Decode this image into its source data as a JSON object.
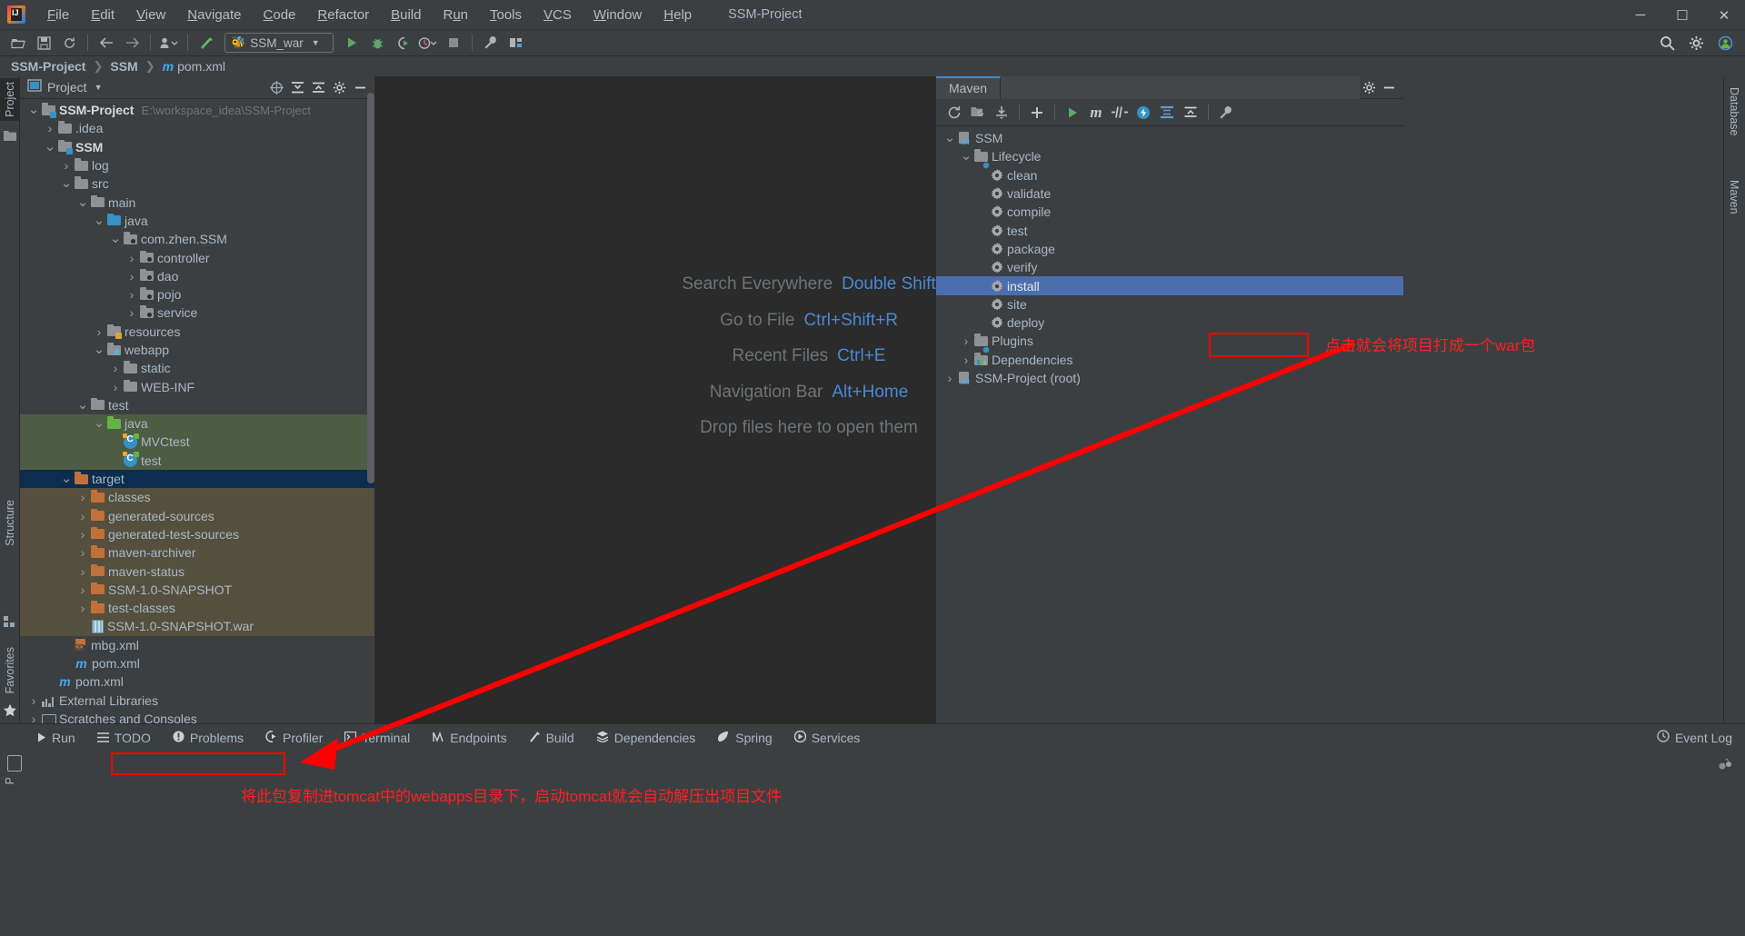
{
  "window": {
    "title": "SSM-Project",
    "menus": [
      {
        "label": "File",
        "mnemonic": "F"
      },
      {
        "label": "Edit",
        "mnemonic": "E"
      },
      {
        "label": "View",
        "mnemonic": "V"
      },
      {
        "label": "Navigate",
        "mnemonic": "N"
      },
      {
        "label": "Code",
        "mnemonic": "C"
      },
      {
        "label": "Refactor",
        "mnemonic": "R"
      },
      {
        "label": "Build",
        "mnemonic": "B"
      },
      {
        "label": "Run",
        "mnemonic": "R"
      },
      {
        "label": "Tools",
        "mnemonic": "T"
      },
      {
        "label": "VCS",
        "mnemonic": "V"
      },
      {
        "label": "Window",
        "mnemonic": "W"
      },
      {
        "label": "Help",
        "mnemonic": "H"
      }
    ],
    "controls": {
      "minimize": "—",
      "maximize": "❐",
      "close": "✕"
    }
  },
  "toolbar": {
    "run_config": "SSM_war",
    "buttons": [
      "open-folder-icon",
      "save-icon",
      "sync-icon",
      "back-arrow-icon",
      "forward-arrow-icon",
      "profile-dropdown-icon",
      "ant-build-icon"
    ],
    "run_buttons": [
      "run-icon",
      "debug-icon",
      "run-with-coverage-icon",
      "profile-icon",
      "stop-icon"
    ],
    "right_buttons": [
      "settings-wrench-icon",
      "project-structure-icon"
    ],
    "far_right_buttons": [
      "search-icon",
      "gear-icon",
      "account-icon"
    ]
  },
  "breadcrumb": {
    "items": [
      "SSM-Project",
      "SSM",
      "pom.xml"
    ],
    "separator": "›"
  },
  "left_strip": {
    "tabs": [
      {
        "label": "Project",
        "active": true
      },
      {
        "label": "Structure",
        "active": false
      },
      {
        "label": "Favorites",
        "active": false
      },
      {
        "label": "Persistence",
        "active": false
      }
    ]
  },
  "right_strip": {
    "tabs": [
      {
        "label": "Database"
      },
      {
        "label": "Maven"
      }
    ]
  },
  "project_panel": {
    "title": "Project",
    "header_icons": [
      "target-icon",
      "collapse-all-icon",
      "expand-all-icon",
      "settings-gear-icon",
      "hide-icon"
    ],
    "tree": [
      {
        "depth": 0,
        "label": "SSM-Project",
        "sub": "E:\\workspace_idea\\SSM-Project",
        "twisty": "v",
        "icon": "folder-module",
        "bold": true,
        "bg": ""
      },
      {
        "depth": 1,
        "label": ".idea",
        "sub": "",
        "twisty": ">",
        "icon": "folder-gray",
        "bold": false,
        "bg": ""
      },
      {
        "depth": 1,
        "label": "SSM",
        "sub": "",
        "twisty": "v",
        "icon": "folder-module",
        "bold": true,
        "bg": ""
      },
      {
        "depth": 2,
        "label": "log",
        "sub": "",
        "twisty": ">",
        "icon": "folder-gray",
        "bold": false,
        "bg": ""
      },
      {
        "depth": 2,
        "label": "src",
        "sub": "",
        "twisty": "v",
        "icon": "folder-gray",
        "bold": false,
        "bg": ""
      },
      {
        "depth": 3,
        "label": "main",
        "sub": "",
        "twisty": "v",
        "icon": "folder-gray",
        "bold": false,
        "bg": ""
      },
      {
        "depth": 4,
        "label": "java",
        "sub": "",
        "twisty": "v",
        "icon": "folder-teal",
        "bold": false,
        "bg": ""
      },
      {
        "depth": 5,
        "label": "com.zhen.SSM",
        "sub": "",
        "twisty": "v",
        "icon": "package",
        "bold": false,
        "bg": ""
      },
      {
        "depth": 6,
        "label": "controller",
        "sub": "",
        "twisty": ">",
        "icon": "package",
        "bold": false,
        "bg": ""
      },
      {
        "depth": 6,
        "label": "dao",
        "sub": "",
        "twisty": ">",
        "icon": "package",
        "bold": false,
        "bg": ""
      },
      {
        "depth": 6,
        "label": "pojo",
        "sub": "",
        "twisty": ">",
        "icon": "package",
        "bold": false,
        "bg": ""
      },
      {
        "depth": 6,
        "label": "service",
        "sub": "",
        "twisty": ">",
        "icon": "package",
        "bold": false,
        "bg": ""
      },
      {
        "depth": 4,
        "label": "resources",
        "sub": "",
        "twisty": ">",
        "icon": "folder-resources",
        "bold": false,
        "bg": ""
      },
      {
        "depth": 4,
        "label": "webapp",
        "sub": "",
        "twisty": "v",
        "icon": "folder-webapp",
        "bold": false,
        "bg": ""
      },
      {
        "depth": 5,
        "label": "static",
        "sub": "",
        "twisty": ">",
        "icon": "folder-gray",
        "bold": false,
        "bg": ""
      },
      {
        "depth": 5,
        "label": "WEB-INF",
        "sub": "",
        "twisty": ">",
        "icon": "folder-gray",
        "bold": false,
        "bg": ""
      },
      {
        "depth": 3,
        "label": "test",
        "sub": "",
        "twisty": "v",
        "icon": "folder-gray",
        "bold": false,
        "bg": ""
      },
      {
        "depth": 4,
        "label": "java",
        "sub": "",
        "twisty": "v",
        "icon": "folder-green",
        "bold": false,
        "bg": "green"
      },
      {
        "depth": 5,
        "label": "MVCtest",
        "sub": "",
        "twisty": "",
        "icon": "class",
        "bold": false,
        "bg": "green"
      },
      {
        "depth": 5,
        "label": "test",
        "sub": "",
        "twisty": "",
        "icon": "class",
        "bold": false,
        "bg": "green"
      },
      {
        "depth": 2,
        "label": "target",
        "sub": "",
        "twisty": "v",
        "icon": "folder-orange",
        "bold": false,
        "bg": "selected"
      },
      {
        "depth": 3,
        "label": "classes",
        "sub": "",
        "twisty": ">",
        "icon": "folder-orange",
        "bold": false,
        "bg": "brown"
      },
      {
        "depth": 3,
        "label": "generated-sources",
        "sub": "",
        "twisty": ">",
        "icon": "folder-orange",
        "bold": false,
        "bg": "brown"
      },
      {
        "depth": 3,
        "label": "generated-test-sources",
        "sub": "",
        "twisty": ">",
        "icon": "folder-orange",
        "bold": false,
        "bg": "brown"
      },
      {
        "depth": 3,
        "label": "maven-archiver",
        "sub": "",
        "twisty": ">",
        "icon": "folder-orange",
        "bold": false,
        "bg": "brown"
      },
      {
        "depth": 3,
        "label": "maven-status",
        "sub": "",
        "twisty": ">",
        "icon": "folder-orange",
        "bold": false,
        "bg": "brown"
      },
      {
        "depth": 3,
        "label": "SSM-1.0-SNAPSHOT",
        "sub": "",
        "twisty": ">",
        "icon": "folder-orange",
        "bold": false,
        "bg": "brown"
      },
      {
        "depth": 3,
        "label": "test-classes",
        "sub": "",
        "twisty": ">",
        "icon": "folder-orange",
        "bold": false,
        "bg": "brown"
      },
      {
        "depth": 3,
        "label": "SSM-1.0-SNAPSHOT.war",
        "sub": "",
        "twisty": "",
        "icon": "war",
        "bold": false,
        "bg": "brown"
      },
      {
        "depth": 2,
        "label": "mbg.xml",
        "sub": "",
        "twisty": "",
        "icon": "mbg",
        "bold": false,
        "bg": ""
      },
      {
        "depth": 2,
        "label": "pom.xml",
        "sub": "",
        "twisty": "",
        "icon": "maven-m",
        "bold": false,
        "bg": ""
      },
      {
        "depth": 1,
        "label": "pom.xml",
        "sub": "",
        "twisty": "",
        "icon": "maven-m",
        "bold": false,
        "bg": ""
      },
      {
        "depth": 0,
        "label": "External Libraries",
        "sub": "",
        "twisty": ">",
        "icon": "libraries",
        "bold": false,
        "bg": ""
      },
      {
        "depth": 0,
        "label": "Scratches and Consoles",
        "sub": "",
        "twisty": ">",
        "icon": "scratches",
        "bold": false,
        "bg": ""
      }
    ]
  },
  "editor": {
    "hints": [
      {
        "label": "Search Everywhere",
        "key": "Double Shift"
      },
      {
        "label": "Go to File",
        "key": "Ctrl+Shift+R"
      },
      {
        "label": "Recent Files",
        "key": "Ctrl+E"
      },
      {
        "label": "Navigation Bar",
        "key": "Alt+Home"
      },
      {
        "label": "Drop files here to open them",
        "key": ""
      }
    ]
  },
  "maven_panel": {
    "title": "Maven",
    "header_icons": [
      "settings-gear-icon",
      "hide-icon"
    ],
    "toolbar_icons": [
      "reload-all-icon",
      "generate-sources-icon",
      "download-sources-icon",
      "add-maven-project-icon",
      "run-icon",
      "execute-goal-icon",
      "toggle-skip-tests-icon",
      "toggle-offline-icon",
      "collapse-all-icon",
      "expand-all-icon",
      "maven-settings-icon"
    ],
    "tree": [
      {
        "depth": 0,
        "label": "SSM",
        "twisty": "v",
        "icon": "maven-project",
        "selected": false
      },
      {
        "depth": 1,
        "label": "Lifecycle",
        "twisty": "v",
        "icon": "folder-gear",
        "selected": false
      },
      {
        "depth": 2,
        "label": "clean",
        "twisty": "",
        "icon": "gear",
        "selected": false
      },
      {
        "depth": 2,
        "label": "validate",
        "twisty": "",
        "icon": "gear",
        "selected": false
      },
      {
        "depth": 2,
        "label": "compile",
        "twisty": "",
        "icon": "gear",
        "selected": false
      },
      {
        "depth": 2,
        "label": "test",
        "twisty": "",
        "icon": "gear",
        "selected": false
      },
      {
        "depth": 2,
        "label": "package",
        "twisty": "",
        "icon": "gear",
        "selected": false
      },
      {
        "depth": 2,
        "label": "verify",
        "twisty": "",
        "icon": "gear",
        "selected": false
      },
      {
        "depth": 2,
        "label": "install",
        "twisty": "",
        "icon": "gear",
        "selected": true
      },
      {
        "depth": 2,
        "label": "site",
        "twisty": "",
        "icon": "gear",
        "selected": false
      },
      {
        "depth": 2,
        "label": "deploy",
        "twisty": "",
        "icon": "gear",
        "selected": false
      },
      {
        "depth": 1,
        "label": "Plugins",
        "twisty": ">",
        "icon": "folder-gear",
        "selected": false
      },
      {
        "depth": 1,
        "label": "Dependencies",
        "twisty": ">",
        "icon": "folder-deps",
        "selected": false
      },
      {
        "depth": 0,
        "label": "SSM-Project (root)",
        "twisty": ">",
        "icon": "maven-project",
        "selected": false
      }
    ]
  },
  "bottom_bar": {
    "items": [
      {
        "label": "Run",
        "icon": "play-icon"
      },
      {
        "label": "TODO",
        "icon": "list-icon"
      },
      {
        "label": "Problems",
        "icon": "warning-icon"
      },
      {
        "label": "Profiler",
        "icon": "profiler-icon"
      },
      {
        "label": "Terminal",
        "icon": "terminal-icon"
      },
      {
        "label": "Endpoints",
        "icon": "endpoints-icon"
      },
      {
        "label": "Build",
        "icon": "hammer-icon"
      },
      {
        "label": "Dependencies",
        "icon": "layers-icon"
      },
      {
        "label": "Spring",
        "icon": "spring-leaf-icon"
      },
      {
        "label": "Services",
        "icon": "services-icon"
      }
    ],
    "event_log": "Event Log",
    "event_log_icon": "clock-icon"
  },
  "annotations": {
    "install_note": "点击就会将项目打成一个war包",
    "war_note": "将此包复制进tomcat中的webapps目录下，启动tomcat就会自动解压出项目文件",
    "color": "#ff0000"
  }
}
